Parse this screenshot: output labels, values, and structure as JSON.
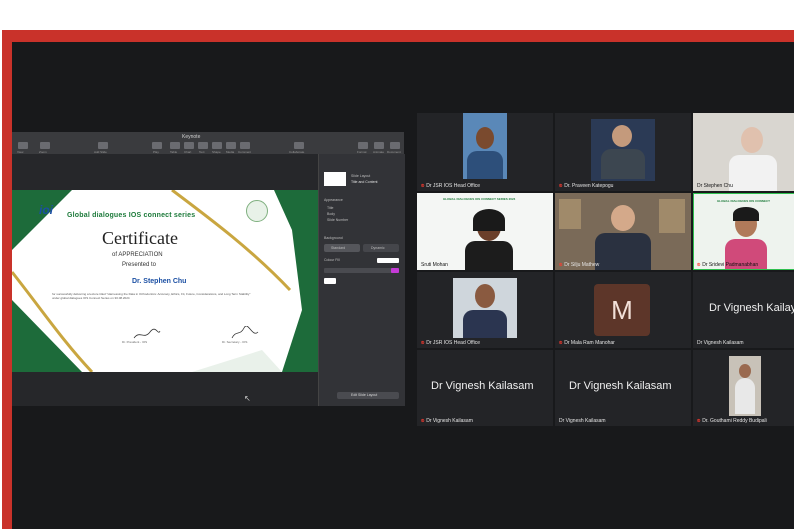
{
  "share": {
    "window_title": "Keynote",
    "toolbar": [
      "View",
      "Zoom",
      "Add Slide",
      "Play",
      "Table",
      "Chart",
      "Text",
      "Shape",
      "Media",
      "Comment",
      "Collaborate",
      "Format",
      "Animate",
      "Document"
    ],
    "side_panel": {
      "layout_label": "Slide Layout",
      "layout_value": "Title and Content",
      "appearance": "Appearance",
      "opt_title": "Title",
      "opt_body": "Body",
      "opt_slide_number": "Slide Number",
      "background": "Background",
      "btn_standard": "Standard",
      "btn_dynamic": "Dynamic",
      "colour_fill": "Colour Fill",
      "edit_layout": "Edit Slide Layout"
    }
  },
  "certificate": {
    "logo": "ioi",
    "series": "Global dialogues IOS connect series",
    "title": "Certificate",
    "subtitle": "of APPRECIATION",
    "presented": "Presented to",
    "name": "Dr. Stephen Chu",
    "body": "for successfully delivering a lecture titled \"Harnessing the Data in Orthodontics: Accuracy, Ethics, Fit, Future, Considerations, and Long Term Stability\" under global dialogues IOS Connect Series on 30.08.2024",
    "sig_left": "Dr. President - IOS",
    "sig_right": "Dr. Secretary - IOS"
  },
  "participants": [
    {
      "name": "Dr JSR IOS Head Office",
      "muted": true
    },
    {
      "name": "Dr. Praveen Katepogu",
      "muted": true
    },
    {
      "name": "Dr Stephen Chu",
      "muted": false
    },
    {
      "name": "Sruti Mohan",
      "muted": false
    },
    {
      "name": "Dr Silju Mathew",
      "muted": true
    },
    {
      "name": "Dr Sridevi Padmanabhan",
      "muted": true
    },
    {
      "name": "Dr JSR IOS Head Office",
      "muted": true
    },
    {
      "name": "Dr Mala Ram Manohar",
      "muted": true,
      "initial": "M"
    },
    {
      "name": "Dr Vignesh Kailasam",
      "muted": false,
      "big": "Dr Vignesh Kailay"
    },
    {
      "name": "Dr Vignesh Kailasam",
      "muted": true,
      "big": "Dr Vignesh Kailasam"
    },
    {
      "name": "Dr Vignesh Kailasam",
      "muted": false,
      "big": "Dr Vignesh Kailasam"
    },
    {
      "name": "Dr. Gouthami Reddy Budipali",
      "muted": true
    }
  ],
  "colors": {
    "frame": "#c9322a",
    "bg": "#18191b",
    "tile": "#232427",
    "highlight": "#2fbf4f"
  }
}
